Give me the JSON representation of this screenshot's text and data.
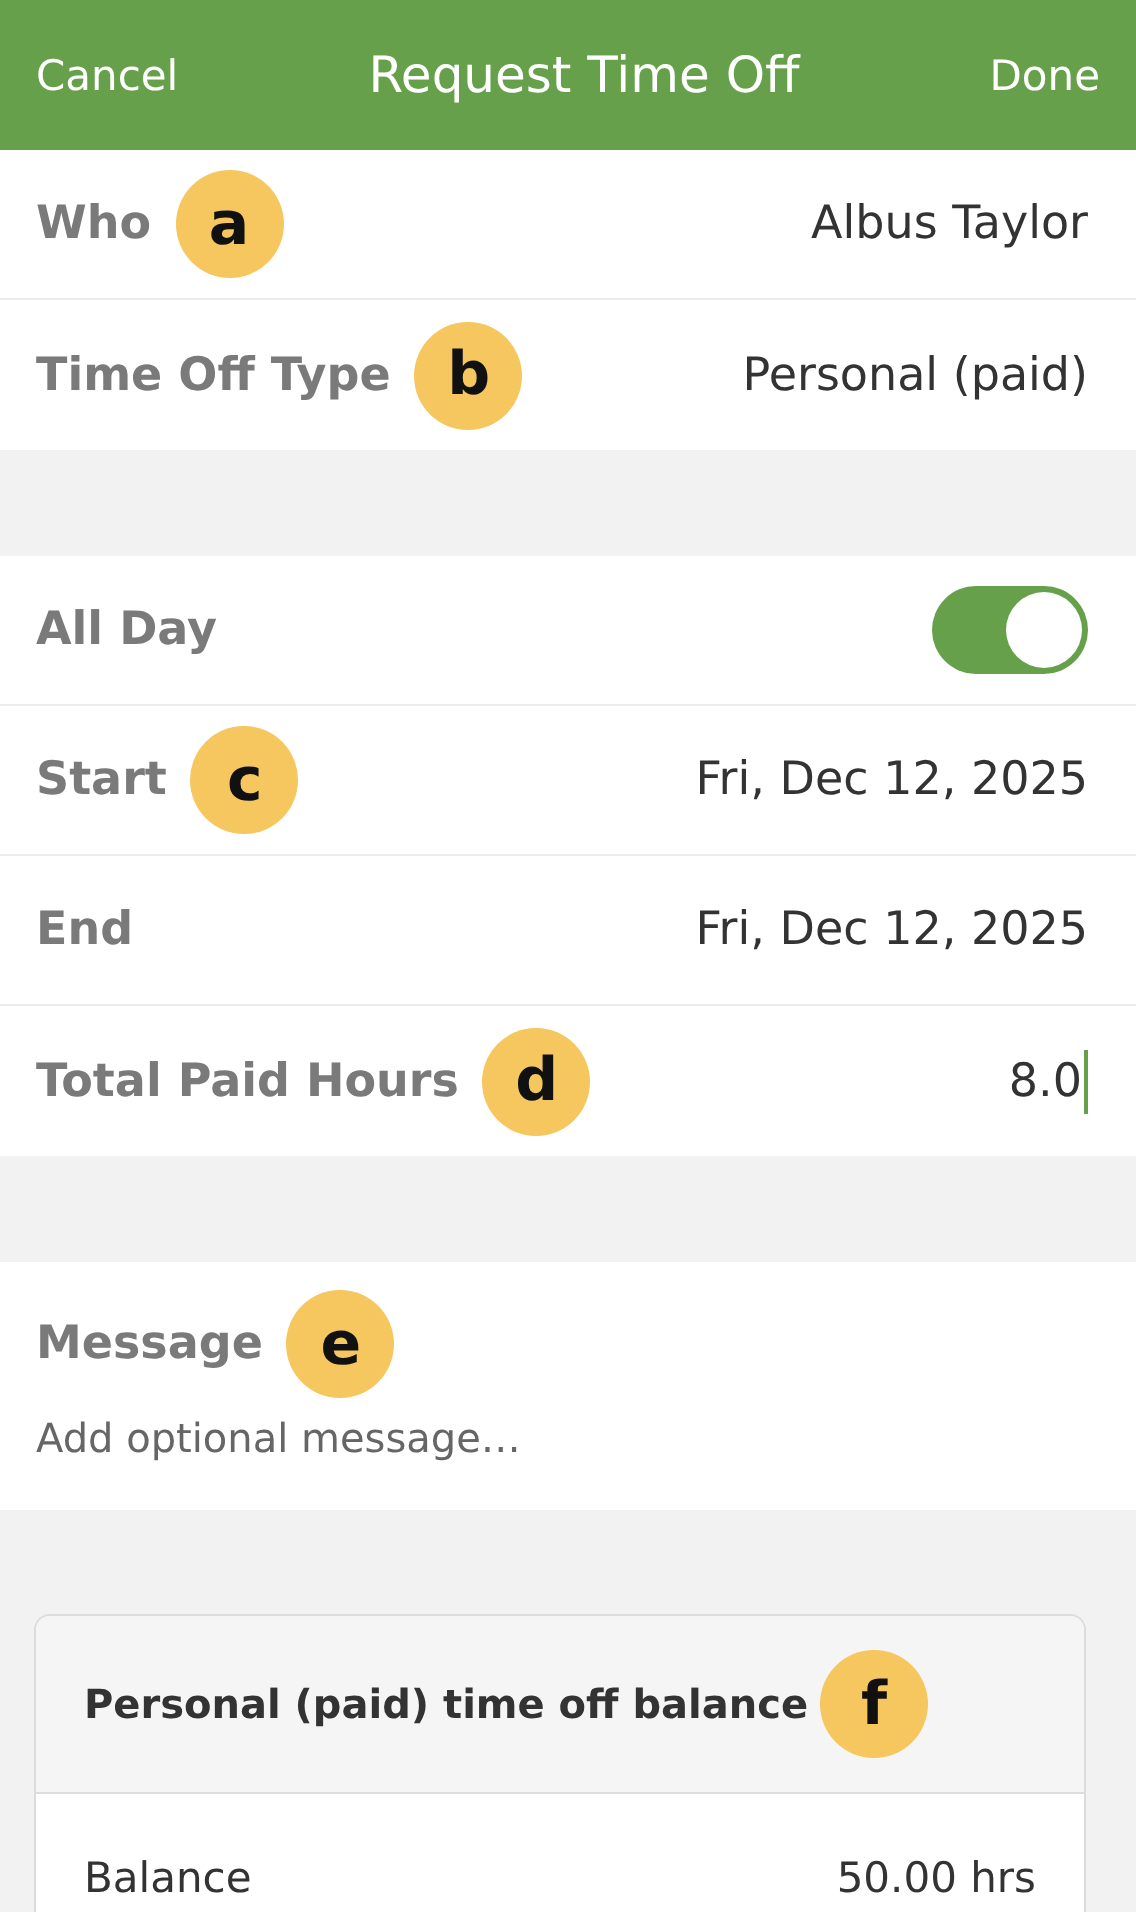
{
  "header": {
    "cancel": "Cancel",
    "title": "Request Time Off",
    "done": "Done"
  },
  "sections": [
    {
      "rows": [
        {
          "kind": "value",
          "label": "Who",
          "value": "Albus Taylor",
          "badge": "a"
        },
        {
          "kind": "value",
          "label": "Time Off Type",
          "value": "Personal (paid)",
          "badge": "b"
        }
      ]
    },
    {
      "rows": [
        {
          "kind": "toggle",
          "label": "All Day",
          "on": true
        },
        {
          "kind": "value",
          "label": "Start",
          "value": "Fri, Dec 12, 2025",
          "badge": "c"
        },
        {
          "kind": "value",
          "label": "End",
          "value": "Fri, Dec 12, 2025"
        },
        {
          "kind": "input",
          "label": "Total Paid Hours",
          "value": "8.0",
          "focused": true,
          "badge": "d"
        }
      ]
    }
  ],
  "message": {
    "label": "Message",
    "badge": "e",
    "placeholder": "Add optional message…"
  },
  "balance_card": {
    "title": "Personal (paid) time off balance",
    "badge": "f",
    "rows": [
      {
        "label": "Balance",
        "value": "50.00 hrs"
      }
    ]
  }
}
